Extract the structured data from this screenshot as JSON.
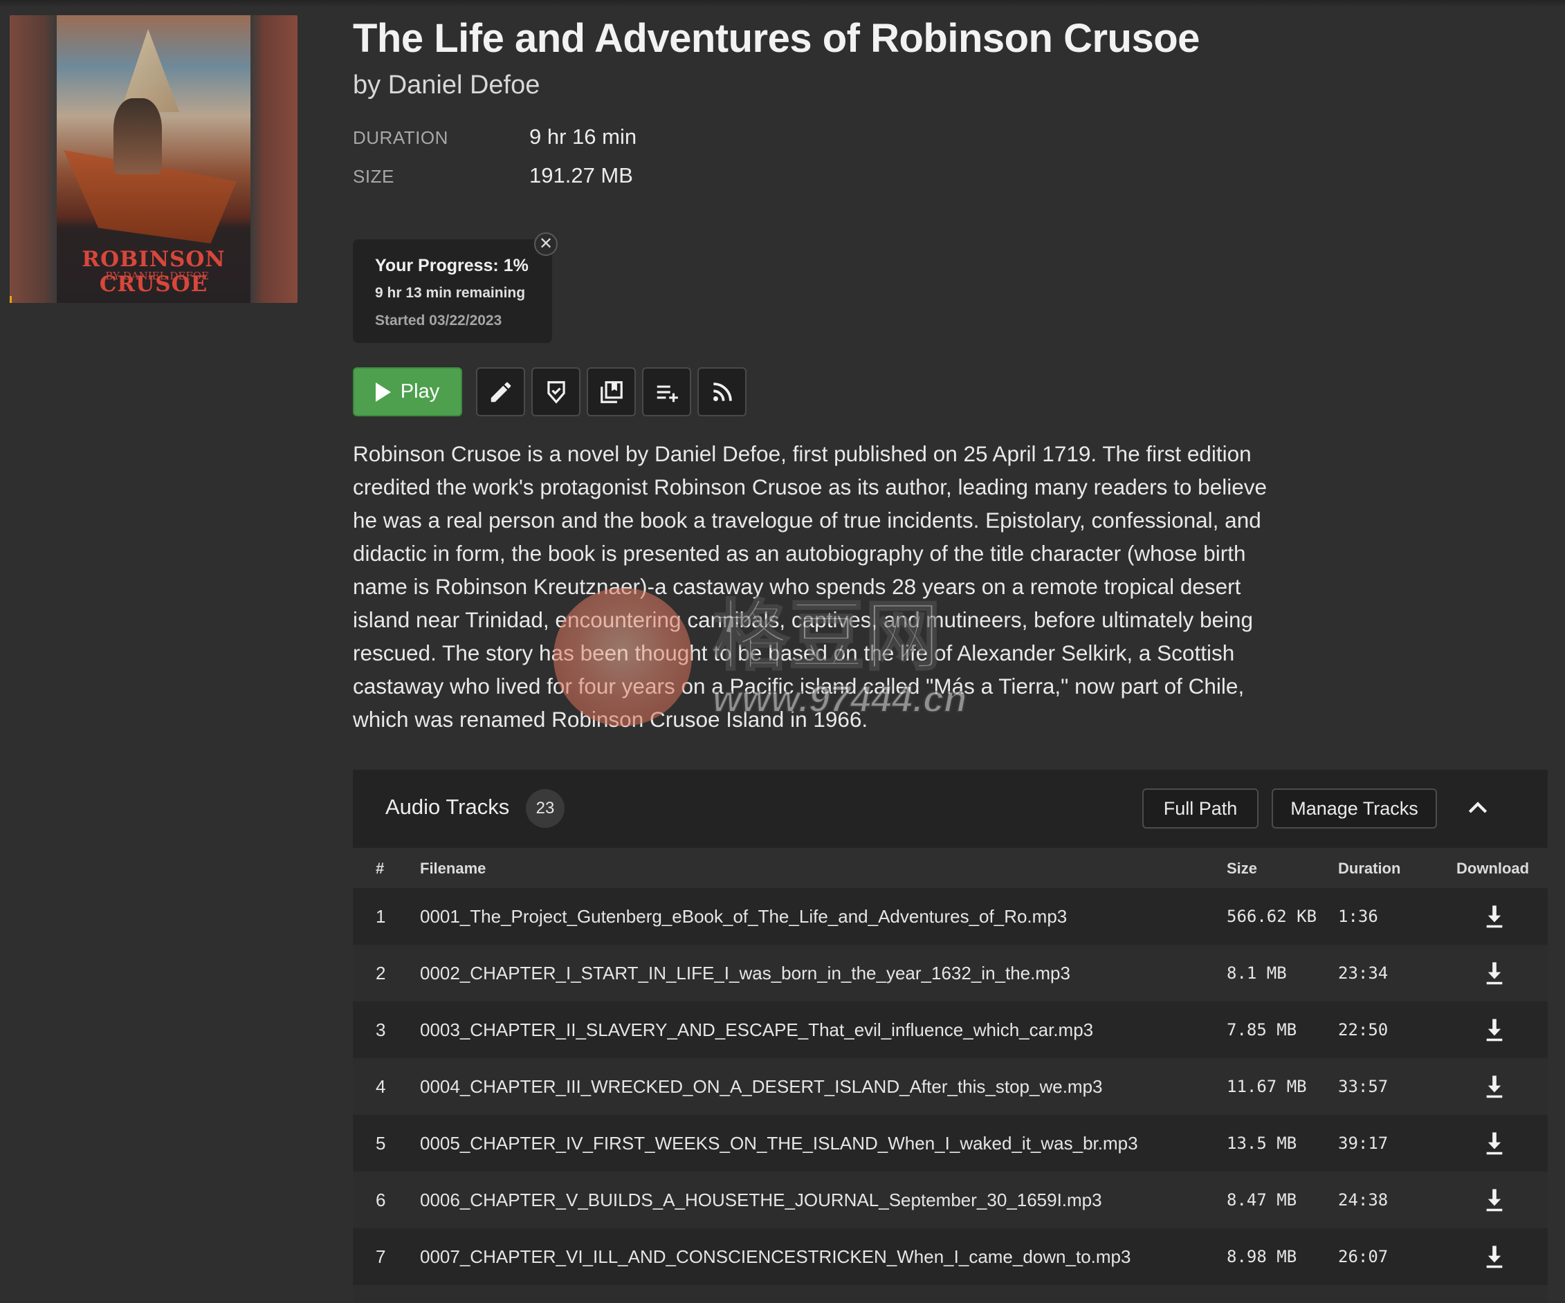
{
  "book": {
    "title": "The Life and Adventures of Robinson Crusoe",
    "author": "by Daniel Defoe",
    "cover_title": "ROBINSON CRUSOE",
    "cover_author": "BY DANIEL DEFOE"
  },
  "meta": {
    "duration_label": "DURATION",
    "duration_value": "9 hr 16 min",
    "size_label": "SIZE",
    "size_value": "191.27 MB"
  },
  "progress": {
    "title": "Your Progress: 1%",
    "percent": 1,
    "remaining": "9 hr 13 min remaining",
    "started": "Started 03/22/2023",
    "close_glyph": "✕"
  },
  "toolbar": {
    "play_label": "Play",
    "icons": [
      "pencil-icon",
      "shield-check-icon",
      "library-icon",
      "playlist-add-icon",
      "rss-icon"
    ]
  },
  "description": "Robinson Crusoe is a novel by Daniel Defoe, first published on 25 April 1719. The first edition credited the work's protagonist Robinson Crusoe as its author, leading many readers to believe he was a real person and the book a travelogue of true incidents. Epistolary, confessional, and didactic in form, the book is presented as an autobiography of the title character (whose birth name is Robinson Kreutznaer)-a castaway who spends 28 years on a remote tropical desert island near Trinidad, encountering cannibals, captives, and mutineers, before ultimately being rescued. The story has been thought to be based on the life of Alexander Selkirk, a Scottish castaway who lived for four years on a Pacific island called \"Más a Tierra,\" now part of Chile, which was renamed Robinson Crusoe Island in 1966.",
  "watermark": {
    "text": "格豆网",
    "url": "www.97444.cn"
  },
  "tracks": {
    "title": "Audio Tracks",
    "count": "23",
    "full_path_label": "Full Path",
    "manage_label": "Manage Tracks",
    "columns": {
      "num": "#",
      "filename": "Filename",
      "size": "Size",
      "duration": "Duration",
      "download": "Download"
    },
    "rows": [
      {
        "num": "1",
        "filename": "0001_The_Project_Gutenberg_eBook_of_The_Life_and_Adventures_of_Ro.mp3",
        "size": "566.62 KB",
        "duration": "1:36"
      },
      {
        "num": "2",
        "filename": "0002_CHAPTER_I_START_IN_LIFE_I_was_born_in_the_year_1632_in_the.mp3",
        "size": "8.1 MB",
        "duration": "23:34"
      },
      {
        "num": "3",
        "filename": "0003_CHAPTER_II_SLAVERY_AND_ESCAPE_That_evil_influence_which_car.mp3",
        "size": "7.85 MB",
        "duration": "22:50"
      },
      {
        "num": "4",
        "filename": "0004_CHAPTER_III_WRECKED_ON_A_DESERT_ISLAND_After_this_stop_we.mp3",
        "size": "11.67 MB",
        "duration": "33:57"
      },
      {
        "num": "5",
        "filename": "0005_CHAPTER_IV_FIRST_WEEKS_ON_THE_ISLAND_When_I_waked_it_was_br.mp3",
        "size": "13.5 MB",
        "duration": "39:17"
      },
      {
        "num": "6",
        "filename": "0006_CHAPTER_V_BUILDS_A_HOUSETHE_JOURNAL_September_30_1659I.mp3",
        "size": "8.47 MB",
        "duration": "24:38"
      },
      {
        "num": "7",
        "filename": "0007_CHAPTER_VI_ILL_AND_CONSCIENCESTRICKEN_When_I_came_down_to.mp3",
        "size": "8.98 MB",
        "duration": "26:07"
      }
    ]
  }
}
